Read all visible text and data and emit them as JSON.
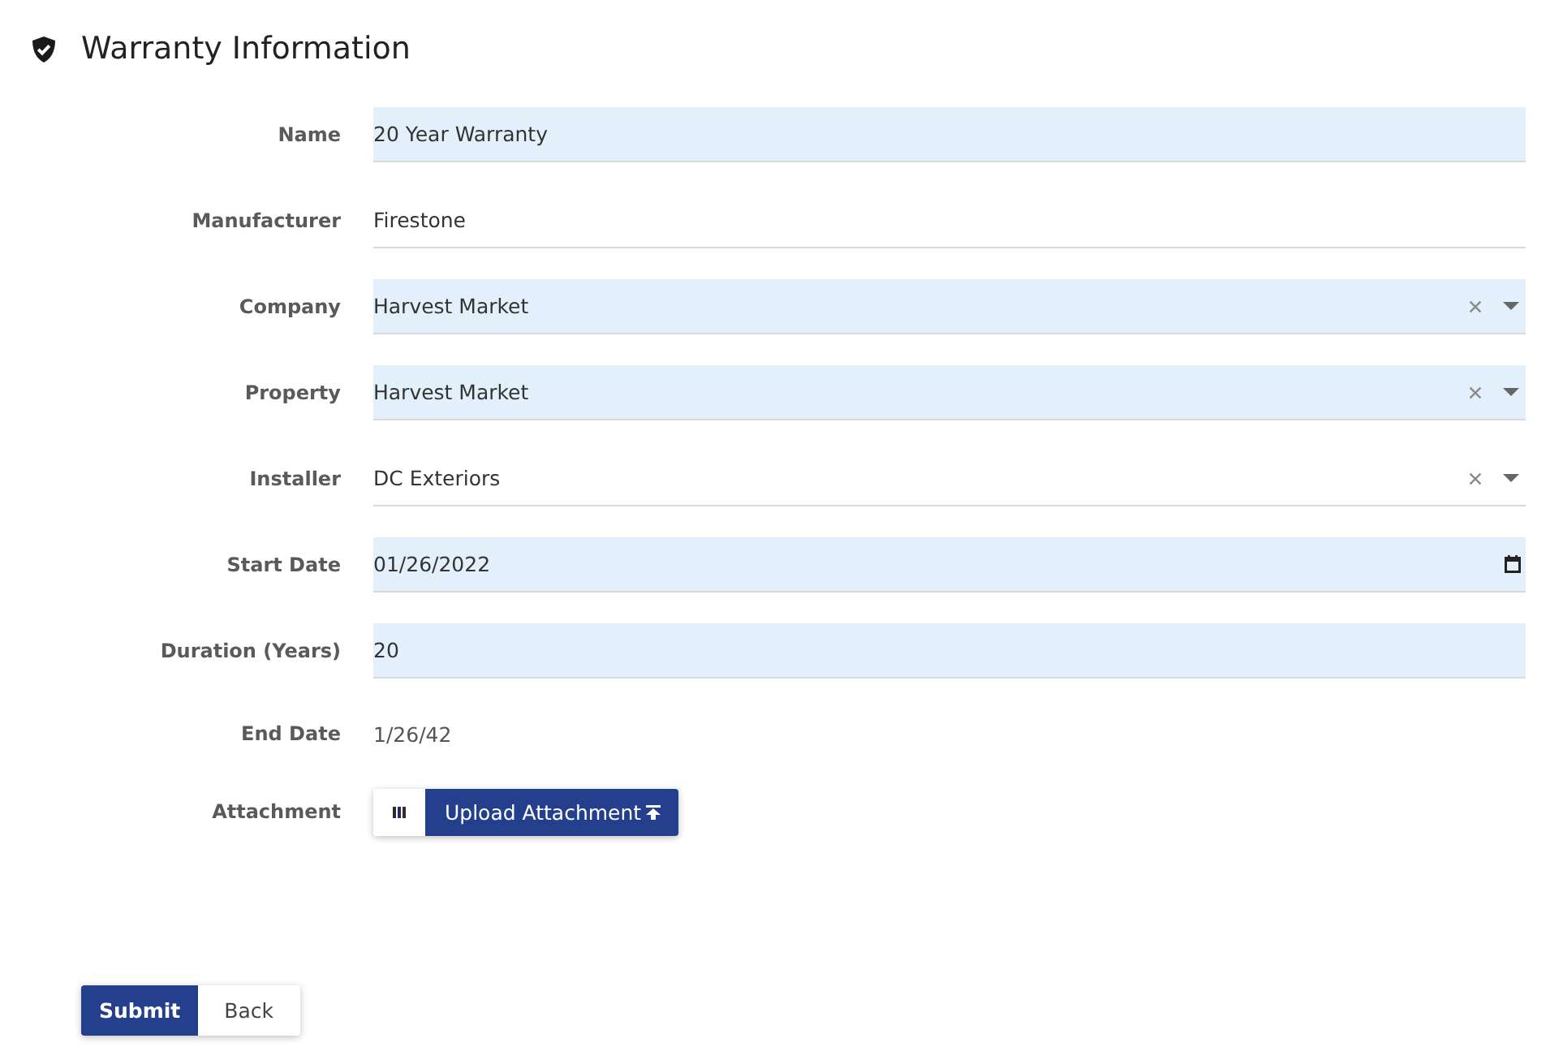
{
  "header": {
    "title": "Warranty Information"
  },
  "fields": [
    {
      "label": "Name",
      "kind": "text",
      "value": "20 Year Warranty",
      "highlighted": true
    },
    {
      "label": "Manufacturer",
      "kind": "text",
      "value": "Firestone",
      "highlighted": false
    },
    {
      "label": "Company",
      "kind": "select",
      "value": "Harvest Market",
      "highlighted": true
    },
    {
      "label": "Property",
      "kind": "select",
      "value": "Harvest Market",
      "highlighted": true
    },
    {
      "label": "Installer",
      "kind": "select",
      "value": "DC Exteriors",
      "highlighted": false
    },
    {
      "label": "Start Date",
      "kind": "date",
      "value": "01/26/2022",
      "highlighted": true
    },
    {
      "label": "Duration (Years)",
      "kind": "text",
      "value": "20",
      "highlighted": true
    },
    {
      "label": "End Date",
      "kind": "static",
      "value": "1/26/42"
    },
    {
      "label": "Attachment",
      "kind": "upload",
      "button": "Upload Attachment"
    }
  ],
  "actions": [
    {
      "label": "Submit",
      "kind": "primary"
    },
    {
      "label": "Back",
      "kind": "secondary"
    }
  ]
}
